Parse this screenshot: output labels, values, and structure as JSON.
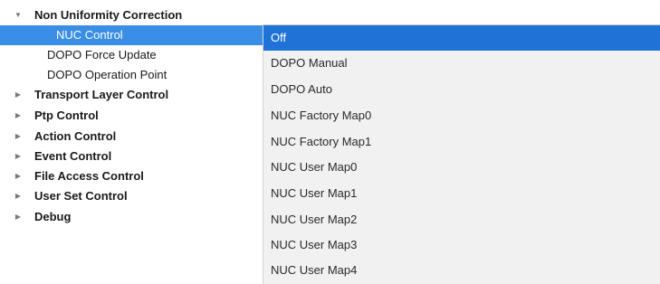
{
  "tree": {
    "root": {
      "label": "Non Uniformity Correction",
      "expanded": true
    },
    "children": [
      {
        "label": "NUC Control",
        "selected": true
      },
      {
        "label": "DOPO Force Update"
      },
      {
        "label": "DOPO Operation Point"
      }
    ],
    "categories": [
      {
        "label": "Transport Layer Control"
      },
      {
        "label": "Ptp Control"
      },
      {
        "label": "Action Control"
      },
      {
        "label": "Event Control"
      },
      {
        "label": "File Access Control"
      },
      {
        "label": "User Set Control"
      },
      {
        "label": "Debug"
      }
    ]
  },
  "dropdown": {
    "options": [
      "Off",
      "DOPO Manual",
      "DOPO Auto",
      "NUC Factory Map0",
      "NUC Factory Map1",
      "NUC User Map0",
      "NUC User Map1",
      "NUC User Map2",
      "NUC User Map3",
      "NUC User Map4"
    ],
    "selected_index": 0
  },
  "colors": {
    "tree_selection": "#3a8ee6",
    "option_highlight": "#1f73d6",
    "dropdown_background": "#f1f1f1"
  },
  "icons": {
    "expanded": "triangle-down-icon",
    "collapsed": "triangle-right-icon"
  }
}
